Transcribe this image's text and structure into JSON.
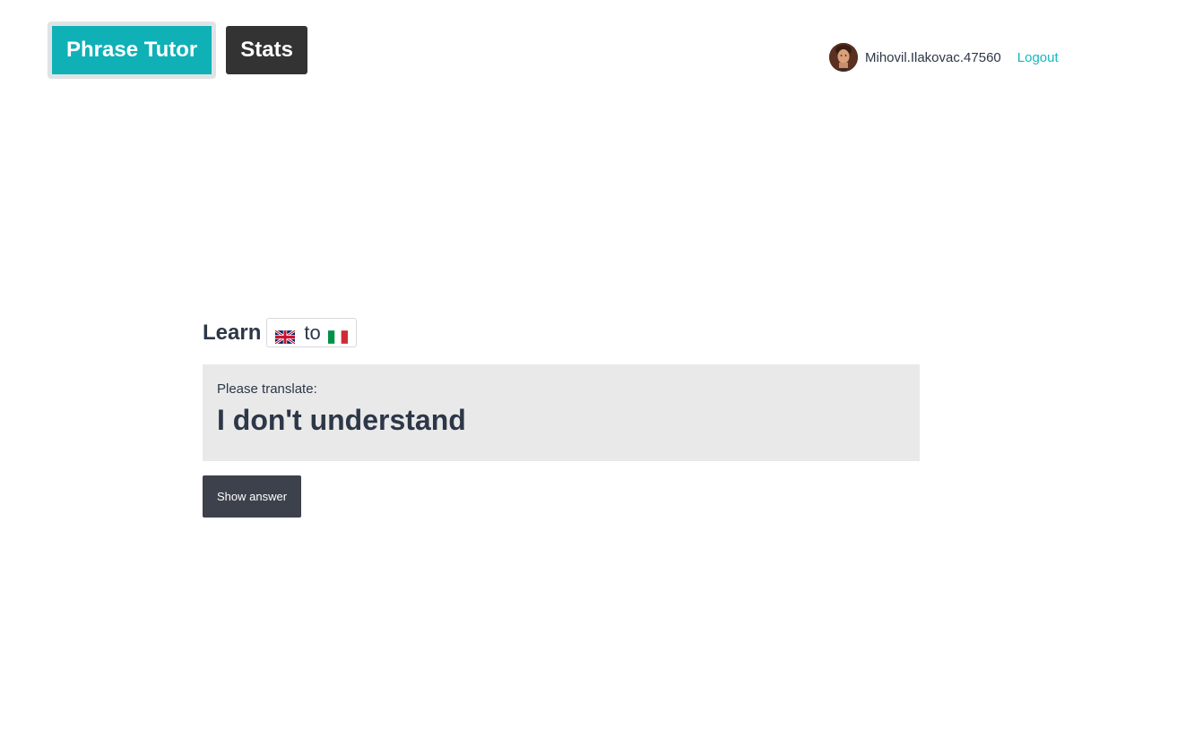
{
  "nav": {
    "brand_label": "Phrase Tutor",
    "stats_label": "Stats",
    "brand_color": "#0fb1b7",
    "stats_color": "#333333"
  },
  "user": {
    "username": "Mihovil.Ilakovac.47560",
    "logout_label": "Logout",
    "avatar_icon": "user-avatar",
    "link_color": "#14b8c0"
  },
  "learn": {
    "title": "Learn",
    "source_flag": "uk-flag-icon",
    "to_label": "to",
    "target_flag": "italy-flag-icon"
  },
  "prompt": {
    "label": "Please translate:",
    "phrase": "I don't understand"
  },
  "actions": {
    "show_answer_label": "Show answer"
  }
}
